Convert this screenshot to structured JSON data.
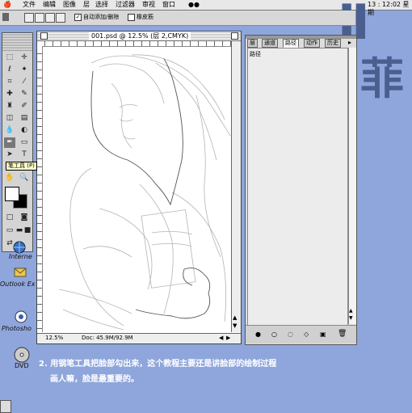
{
  "menubar": {
    "items": [
      "文件",
      "编辑",
      "图像",
      "层",
      "选择",
      "过滤器",
      "审视",
      "窗口"
    ],
    "clock": "13 : 12:02 星期"
  },
  "optionsbar": {
    "checkbox_auto_label": "自动添加/删除",
    "checkbox_rubber_label": "橡皮筋"
  },
  "desktop": {
    "glyph1": "Ⅱ",
    "glyph2": "菲",
    "icons": [
      {
        "label": "Interne",
        "icon": "internet-icon"
      },
      {
        "label": "Outlook Ex",
        "icon": "outlook-icon"
      },
      {
        "label": "Photosho",
        "icon": "photoshop-icon"
      },
      {
        "label": "DVD",
        "icon": "dvd-icon"
      }
    ]
  },
  "toolbox": {
    "tooltip": "笔工具 (P)"
  },
  "document": {
    "title": "001.psd @ 12.5% (层 2,CMYK)",
    "zoom": "12.5%",
    "doc_info": "Doc: 45.9M/92.9M"
  },
  "panel": {
    "tabs": [
      "层",
      "通道",
      "路径",
      "动作",
      "历史"
    ],
    "active_tab": "路径",
    "path_item": "路径"
  },
  "caption": {
    "line1": "2. 用钢笔工具把脸部勾出来，这个教程主要还是讲脸部的绘制过程",
    "line2": "画人嘛，脸是最重要的。"
  }
}
